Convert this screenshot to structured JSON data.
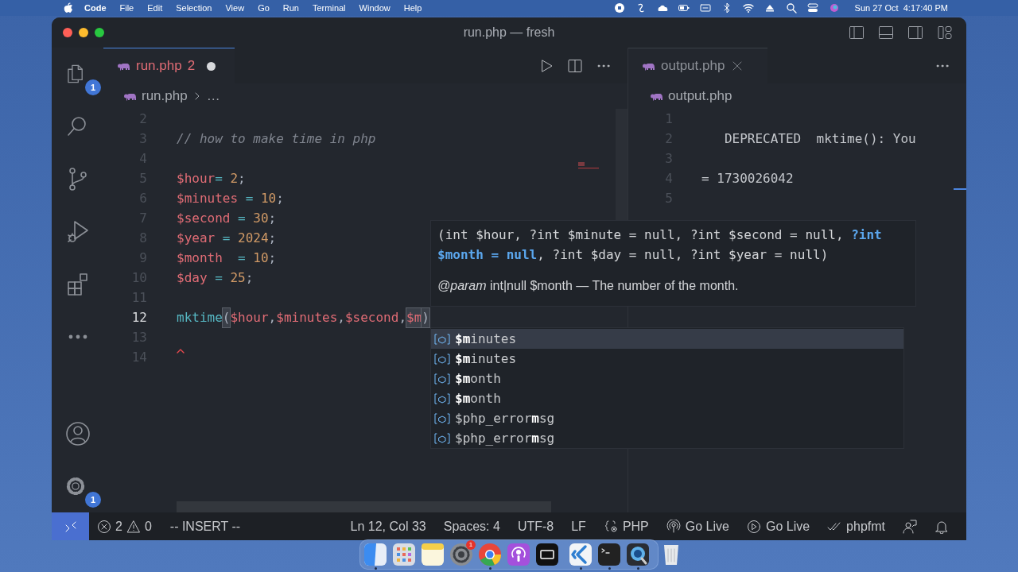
{
  "menu_bar": {
    "app": "Code",
    "items": [
      "File",
      "Edit",
      "Selection",
      "View",
      "Go",
      "Run",
      "Terminal",
      "Window",
      "Help"
    ],
    "clock": "Sun 27 Oct  4:17:40 PM"
  },
  "window": {
    "title": "run.php — fresh"
  },
  "activity_bar": {
    "top": [
      {
        "kind": "explorer",
        "badge": "1"
      },
      {
        "kind": "search"
      },
      {
        "kind": "source-control"
      },
      {
        "kind": "run"
      },
      {
        "kind": "extensions"
      },
      {
        "kind": "more"
      }
    ],
    "bottom": [
      {
        "kind": "account"
      },
      {
        "kind": "settings",
        "badge": "1"
      }
    ]
  },
  "editors": [
    {
      "tab": {
        "label": "run.php",
        "problems": "2",
        "dirty": true,
        "focused": true
      },
      "breadcrumb": [
        "run.php",
        "…"
      ],
      "actions": [
        {
          "kind": "run"
        },
        {
          "kind": "split"
        },
        {
          "kind": "more"
        }
      ],
      "lines": [
        {
          "number": "2",
          "current": false,
          "error": false
        },
        {
          "number": "3",
          "current": false,
          "error": false,
          "tokens": [
            {
              "kind": "comment",
              "text": "// how to make time in php"
            }
          ]
        },
        {
          "number": "4",
          "current": false,
          "error": false
        },
        {
          "number": "5",
          "current": false,
          "error": false,
          "tokens": [
            {
              "kind": "var",
              "text": "$hour"
            },
            {
              "kind": "op",
              "text": "= "
            },
            {
              "kind": "num",
              "text": "2"
            },
            {
              "kind": "punc",
              "text": ";"
            }
          ]
        },
        {
          "number": "6",
          "current": false,
          "error": false,
          "tokens": [
            {
              "kind": "var",
              "text": "$minutes"
            },
            {
              "kind": "op",
              "text": " = "
            },
            {
              "kind": "num",
              "text": "10"
            },
            {
              "kind": "punc",
              "text": ";"
            }
          ]
        },
        {
          "number": "7",
          "current": false,
          "error": false,
          "tokens": [
            {
              "kind": "var",
              "text": "$second"
            },
            {
              "kind": "op",
              "text": " = "
            },
            {
              "kind": "num",
              "text": "30"
            },
            {
              "kind": "punc",
              "text": ";"
            }
          ]
        },
        {
          "number": "8",
          "current": false,
          "error": false,
          "tokens": [
            {
              "kind": "var",
              "text": "$year"
            },
            {
              "kind": "op",
              "text": " = "
            },
            {
              "kind": "num",
              "text": "2024"
            },
            {
              "kind": "punc",
              "text": ";"
            }
          ]
        },
        {
          "number": "9",
          "current": false,
          "error": false,
          "tokens": [
            {
              "kind": "var",
              "text": "$month"
            },
            {
              "kind": "op",
              "text": "  = "
            },
            {
              "kind": "num",
              "text": "10"
            },
            {
              "kind": "punc",
              "text": ";"
            }
          ]
        },
        {
          "number": "10",
          "current": false,
          "error": false,
          "tokens": [
            {
              "kind": "var",
              "text": "$day"
            },
            {
              "kind": "op",
              "text": " = "
            },
            {
              "kind": "num",
              "text": "25"
            },
            {
              "kind": "punc",
              "text": ";"
            }
          ]
        },
        {
          "number": "11",
          "current": false,
          "error": false
        },
        {
          "number": "12",
          "current": true,
          "error": false,
          "tokens": [
            {
              "kind": "func",
              "text": "mktime"
            },
            {
              "kind": "bracket",
              "text": "("
            },
            {
              "kind": "var",
              "text": "$hour"
            },
            {
              "kind": "punc",
              "text": ","
            },
            {
              "kind": "var",
              "text": "$minutes"
            },
            {
              "kind": "punc",
              "text": ","
            },
            {
              "kind": "var",
              "text": "$second"
            },
            {
              "kind": "punc",
              "text": ","
            },
            {
              "kind": "typed",
              "text": "$m"
            },
            {
              "kind": "bracket",
              "text": ")"
            }
          ]
        },
        {
          "number": "13",
          "current": false,
          "error": false
        },
        {
          "number": "14",
          "current": false,
          "error": true
        }
      ]
    },
    {
      "tab": {
        "label": "output.php",
        "dirty": false,
        "focused": false
      },
      "breadcrumb": [
        "output.php"
      ],
      "actions": [
        {
          "kind": "more"
        }
      ],
      "lines": [
        {
          "number": "1",
          "current": false,
          "error": false
        },
        {
          "number": "2",
          "current": false,
          "error": false,
          "tokens": [
            {
              "kind": "plain",
              "text": "   DEPRECATED  mktime(): You"
            }
          ]
        },
        {
          "number": "3",
          "current": false,
          "error": false
        },
        {
          "number": "4",
          "current": false,
          "error": false,
          "tokens": [
            {
              "kind": "plain",
              "text": "= 1730026042"
            }
          ]
        },
        {
          "number": "5",
          "current": false,
          "error": false
        }
      ]
    }
  ],
  "hover": {
    "signature": "(int $hour, ?int $minute = null, ?int $second = null, **?int $month = null**, ?int $day = null, ?int $year = null)",
    "doc": "*@param* int|null $month — The number of the month."
  },
  "suggestions": [
    {
      "label": "**$m**inutes",
      "selected": true
    },
    {
      "label": "**$m**inutes",
      "selected": false
    },
    {
      "label": "**$m**onth",
      "selected": false
    },
    {
      "label": "**$m**onth",
      "selected": false
    },
    {
      "label": "$php_error**m**sg",
      "selected": false
    },
    {
      "label": "$php_error**m**sg",
      "selected": false
    }
  ],
  "status_bar": {
    "errors": "2",
    "warnings": "0",
    "mode": "-- INSERT --",
    "items": [
      {
        "kind": "text",
        "label": "Ln 12, Col 33"
      },
      {
        "kind": "text",
        "label": "Spaces: 4"
      },
      {
        "kind": "text",
        "label": "UTF-8"
      },
      {
        "kind": "text",
        "label": "LF"
      },
      {
        "kind": "language",
        "label": "PHP"
      },
      {
        "kind": "broadcast",
        "label": "Go Live"
      },
      {
        "kind": "play",
        "label": "Go Live"
      },
      {
        "kind": "check",
        "label": "phpfmt"
      },
      {
        "kind": "person"
      },
      {
        "kind": "bell"
      }
    ]
  },
  "dock": [
    {
      "kind": "finder",
      "running": true
    },
    {
      "kind": "launchpad",
      "running": false
    },
    {
      "kind": "notes",
      "running": false
    },
    {
      "kind": "settings",
      "running": false,
      "badge": "1"
    },
    {
      "kind": "browser",
      "running": true
    },
    {
      "kind": "podcasts",
      "running": false
    },
    {
      "kind": "tv",
      "running": false
    },
    {
      "kind": "divider"
    },
    {
      "kind": "code",
      "running": true
    },
    {
      "kind": "terminal",
      "running": true
    },
    {
      "kind": "quicktime",
      "running": true
    },
    {
      "kind": "divider"
    },
    {
      "kind": "trash",
      "running": false
    }
  ]
}
